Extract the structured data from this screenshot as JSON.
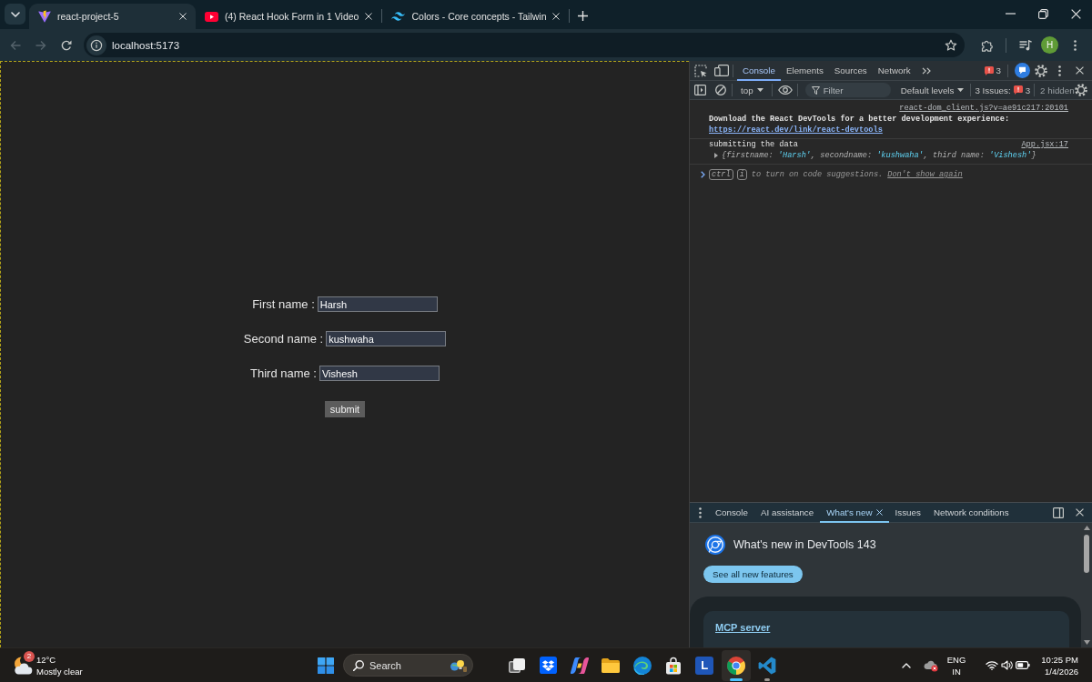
{
  "browser": {
    "tabs": [
      {
        "kind": "bolt-logo",
        "title": "react-project-5",
        "selected": true
      },
      {
        "kind": "play-logo",
        "title": "(4) React Hook Form in 1 Video",
        "selected": false
      },
      {
        "kind": "wave-logo",
        "title": "Colors - Core concepts - Tailwin",
        "selected": false
      }
    ],
    "nav": [
      {
        "kind": "back",
        "disabled": true
      },
      {
        "kind": "forward",
        "disabled": true
      },
      {
        "kind": "reload",
        "disabled": false
      }
    ],
    "address": "localhost:5173",
    "profile_initial": "H"
  },
  "page": {
    "fields": [
      {
        "label": "First name :",
        "value": "Harsh"
      },
      {
        "label": "Second name :",
        "value": "kushwaha"
      },
      {
        "label": "Third name :",
        "value": "Vishesh"
      }
    ],
    "submit_button": "submit"
  },
  "devtools": {
    "tabs": [
      {
        "label": "Console",
        "selected": true
      },
      {
        "label": "Elements",
        "selected": false
      },
      {
        "label": "Sources",
        "selected": false
      },
      {
        "label": "Network",
        "selected": false
      }
    ],
    "error_count": "3",
    "console_toolbar": {
      "context": "top",
      "filter": {
        "placeholder": "Filter"
      },
      "levels": "Default levels",
      "issues_label": "3 Issues:",
      "issues_count": "3",
      "hidden_count": "2 hidden"
    },
    "messages": [
      {
        "source": "react-dom_client.js?v=ae91c217:20101",
        "text": "Download the React DevTools for a better development experience:",
        "bold": true,
        "link": "https://react.dev/link/react-devtools"
      },
      {
        "source": "App.jsx:17",
        "text": "submitting the data",
        "bold": false,
        "object": [
          {
            "kind": "key",
            "text": "{firstname: "
          },
          {
            "kind": "value",
            "text": "'Harsh'"
          },
          {
            "kind": "key",
            "text": ", secondname: "
          },
          {
            "kind": "value",
            "text": "'kushwaha'"
          },
          {
            "kind": "key",
            "text": ", third name: "
          },
          {
            "kind": "value",
            "text": "'Vishesh'"
          },
          {
            "kind": "key",
            "text": "}"
          }
        ]
      }
    ],
    "prompt": {
      "keys": [
        "ctrl",
        "i"
      ],
      "hint": "to turn on code suggestions.",
      "link": "Don't show again"
    }
  },
  "drawer": {
    "tabs": [
      {
        "label": "Console",
        "selected": false,
        "closable": false
      },
      {
        "label": "AI assistance",
        "selected": false,
        "closable": false
      },
      {
        "label": "What's new",
        "selected": true,
        "closable": true
      },
      {
        "label": "Issues",
        "selected": false,
        "closable": false
      },
      {
        "label": "Network conditions",
        "selected": false,
        "closable": false
      }
    ],
    "heading": "What's new in DevTools 143",
    "button": "See all new features",
    "card_link": "MCP server"
  },
  "taskbar": {
    "weather": {
      "alert_count": "2",
      "temperature": "12°C",
      "condition": "Mostly clear"
    },
    "search": {
      "placeholder": "Search"
    },
    "apps": [
      {
        "kind": "task-view",
        "running": false,
        "selected": false
      },
      {
        "kind": "diamond-tile",
        "running": false,
        "selected": false
      },
      {
        "kind": "swirl",
        "running": false,
        "selected": false
      },
      {
        "kind": "folder",
        "running": false,
        "selected": false
      },
      {
        "kind": "wave-circle",
        "running": false,
        "selected": false
      },
      {
        "kind": "shopping-bag",
        "running": false,
        "selected": false
      },
      {
        "kind": "letter-tile",
        "label": "L",
        "running": false,
        "selected": false
      },
      {
        "kind": "color-wheel",
        "running": true,
        "selected": true
      },
      {
        "kind": "ribbon",
        "running": true,
        "selected": false
      }
    ],
    "language": {
      "code": "ENG",
      "region": "IN"
    },
    "time": "10:25 PM",
    "date": "1/4/2026"
  }
}
